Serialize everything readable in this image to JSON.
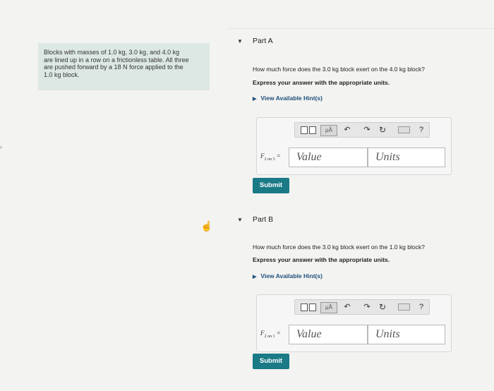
{
  "problem": {
    "lines": "Blocks with masses of 1.0 kg, 3.0 kg, and 4.0 kg\nare lined up in a row on a frictionless table. All three\nare pushed forward by a 18 N force applied to the\n1.0 kg block."
  },
  "partA": {
    "toggle": "▼",
    "title": "Part A",
    "question": "How much force does the 3.0 kg block exert on the 4.0 kg block?",
    "instruction": "Express your answer with the appropriate units.",
    "hint": "View Available Hint(s)",
    "label_main": "F",
    "label_sub": "2 on 3",
    "label_eq": " =",
    "value_placeholder": "Value",
    "units_placeholder": "Units",
    "submit": "Submit"
  },
  "partB": {
    "toggle": "▼",
    "title": "Part B",
    "question": "How much force does the 3.0 kg block exert on the 1.0 kg block?",
    "instruction": "Express your answer with the appropriate units.",
    "hint": "View Available Hint(s)",
    "label_main": "F",
    "label_sub": "2 on 1",
    "label_eq": " =",
    "value_placeholder": "Value",
    "units_placeholder": "Units",
    "submit": "Submit"
  },
  "toolbar": {
    "mu": "μÅ",
    "undo": "↶",
    "redo": "↷",
    "reset": "↻",
    "help": "?"
  },
  "colors": {
    "submit_bg": "#1a7a86",
    "problem_bg": "#dde8e5",
    "hint_link": "#1f4f7a"
  }
}
